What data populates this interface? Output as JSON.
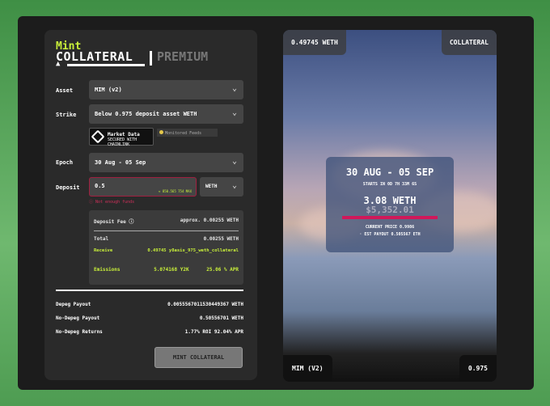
{
  "header": {
    "mint": "Mint",
    "collateral": "COLLATERAL",
    "premium": "PREMIUM"
  },
  "form": {
    "asset_label": "Asset",
    "asset_value": "MIM (v2)",
    "strike_label": "Strike",
    "strike_value": "Below 0.975 deposit asset WETH",
    "chainlink_title": "Market Data",
    "chainlink_sub": "SECURED WITH CHAINLINK",
    "monitored": "Monitored Feeds",
    "epoch_label": "Epoch",
    "epoch_value": "30 Aug - 05 Sep",
    "deposit_label": "Deposit",
    "deposit_value": "0.5",
    "deposit_max": "≈ 850.565 754 MAX",
    "deposit_asset": "WETH",
    "error": "Not enough funds"
  },
  "fees": {
    "deposit_fee_label": "Deposit Fee",
    "deposit_fee_value": "approx. 0.00255 WETH",
    "total_label": "Total",
    "total_value": "0.00255 WETH",
    "receive_label": "Receive",
    "receive_value": "0.49745 y8asis_975_weth_collateral",
    "emissions_label": "Emissions",
    "emissions_value": "5.074168 Y2K",
    "emissions_apr": "25.06 % APR"
  },
  "summary": [
    {
      "label": "Depeg Payout",
      "value": "0.0055567011530449367 WETH"
    },
    {
      "label": "No-Depeg Payout",
      "value": "0.50556701 WETH"
    },
    {
      "label": "No-Depeg Returns",
      "value": "1.77% ROI   92.04% APR"
    }
  ],
  "mint_button": "MINT COLLATERAL",
  "preview": {
    "top_left": "0.49745 WETH",
    "top_right": "COLLATERAL",
    "dates": "30 AUG - 05 SEP",
    "starts": "STARTS IN 0D 7H 33M 6S",
    "amount": "3.08 WETH",
    "usd": "$5,352.01",
    "current_price": "CURRENT PRICE 0.9986",
    "est_payout": "· EST PAYOUT 0.505567 ETH",
    "bottom_left": "MIM (V2)",
    "bottom_right": "0.975"
  },
  "colors": {
    "accent": "#c9f03a",
    "error": "#d0305a"
  }
}
